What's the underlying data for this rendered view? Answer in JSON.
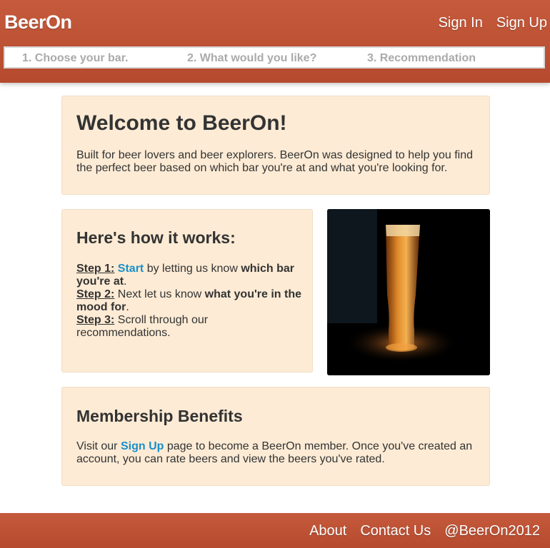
{
  "header": {
    "brand": "BeerOn",
    "sign_in": "Sign In",
    "sign_up": "Sign Up"
  },
  "steps": [
    "1. Choose your bar.",
    "2. What would you like?",
    "3. Recommendation"
  ],
  "welcome": {
    "title": "Welcome to BeerOn!",
    "body": "Built for beer lovers and beer explorers. BeerOn was designed to help you find the perfect beer based on which bar you're at and what you're looking for."
  },
  "how": {
    "title": "Here's how it works:",
    "step1": {
      "label": "Step 1:",
      "link": "Start",
      "text_a": " by letting us know ",
      "bold": "which bar you're at",
      "text_b": "."
    },
    "step2": {
      "label": "Step 2:",
      "text_a": " Next let us know ",
      "bold": "what you're in the mood for",
      "text_b": "."
    },
    "step3": {
      "label": "Step 3:",
      "text_a": " Scroll through our recommendations."
    }
  },
  "membership": {
    "title": "Membership Benefits",
    "text_a": "Visit our ",
    "link": "Sign Up",
    "text_b": " page to become a BeerOn member. Once you've created an account, you can rate beers and view the beers you've rated."
  },
  "footer": {
    "about": "About",
    "contact": "Contact Us",
    "twitter": "@BeerOn2012"
  },
  "colors": {
    "brand": "#c0553a",
    "card": "#fdebd5",
    "link": "#1a8fca"
  },
  "image": {
    "icon": "beer-glass-photo"
  }
}
